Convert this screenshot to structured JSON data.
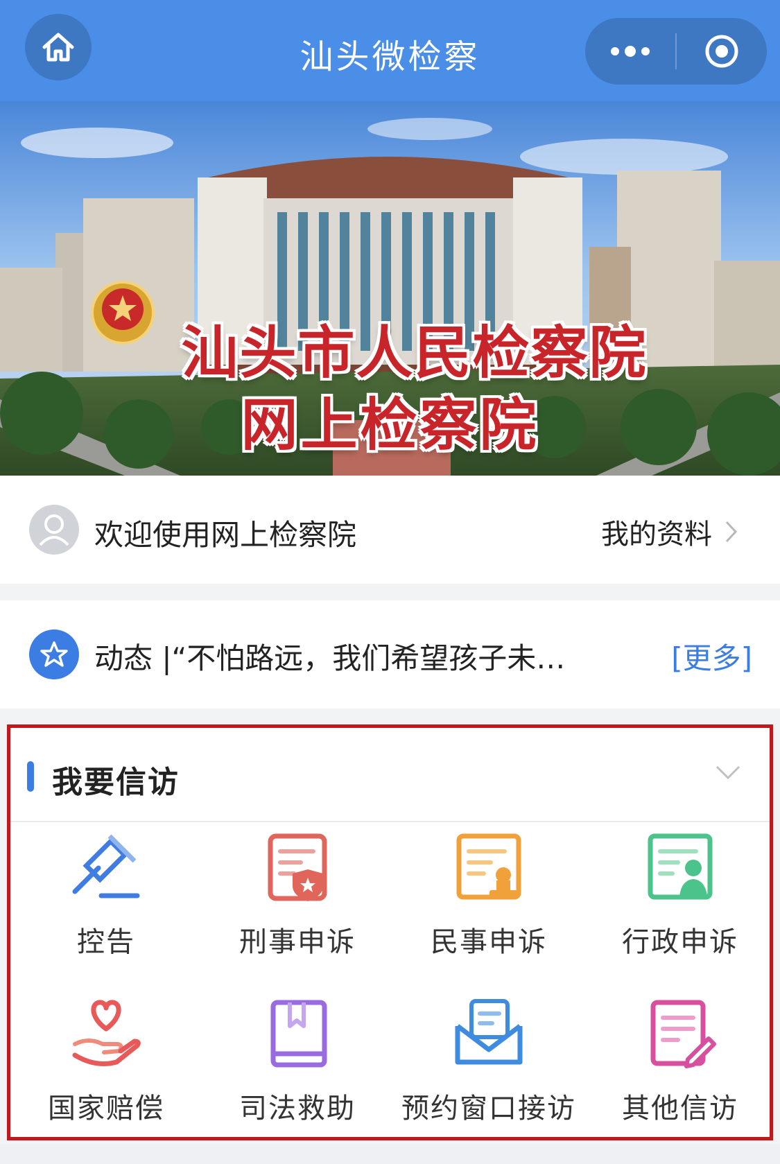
{
  "header": {
    "title": "汕头微检察",
    "home_icon": "home-icon",
    "more_icon": "more-dots-icon",
    "close_icon": "record-circle-icon",
    "color": "#4a8ee8"
  },
  "banner": {
    "line1": "汕头市人民检察院",
    "line2": "网上检察院",
    "emblem": "procuratorate-emblem"
  },
  "welcome": {
    "text": "欢迎使用网上检察院",
    "profile_label": "我的资料",
    "avatar_icon": "user-avatar-icon"
  },
  "news": {
    "text": "动态 |“不怕路远，我们希望孩子未…",
    "more_label": "[更多]",
    "icon": "star-icon",
    "accent": "#3b7de3"
  },
  "section": {
    "title": "我要信访",
    "items": [
      {
        "label": "控告",
        "icon": "gavel-icon",
        "color": "#3f7de0"
      },
      {
        "label": "刑事申诉",
        "icon": "shield-document-icon",
        "color": "#e0655a"
      },
      {
        "label": "民事申诉",
        "icon": "stamp-document-icon",
        "color": "#f0a13a"
      },
      {
        "label": "行政申诉",
        "icon": "person-document-icon",
        "color": "#4cc38a"
      },
      {
        "label": "国家赔偿",
        "icon": "heart-hand-icon",
        "color": "#e85a5a"
      },
      {
        "label": "司法救助",
        "icon": "book-icon",
        "color": "#9a6be0"
      },
      {
        "label": "预约窗口接访",
        "icon": "envelope-icon",
        "color": "#3f8be0"
      },
      {
        "label": "其他信访",
        "icon": "edit-document-icon",
        "color": "#d94fa0"
      }
    ]
  }
}
